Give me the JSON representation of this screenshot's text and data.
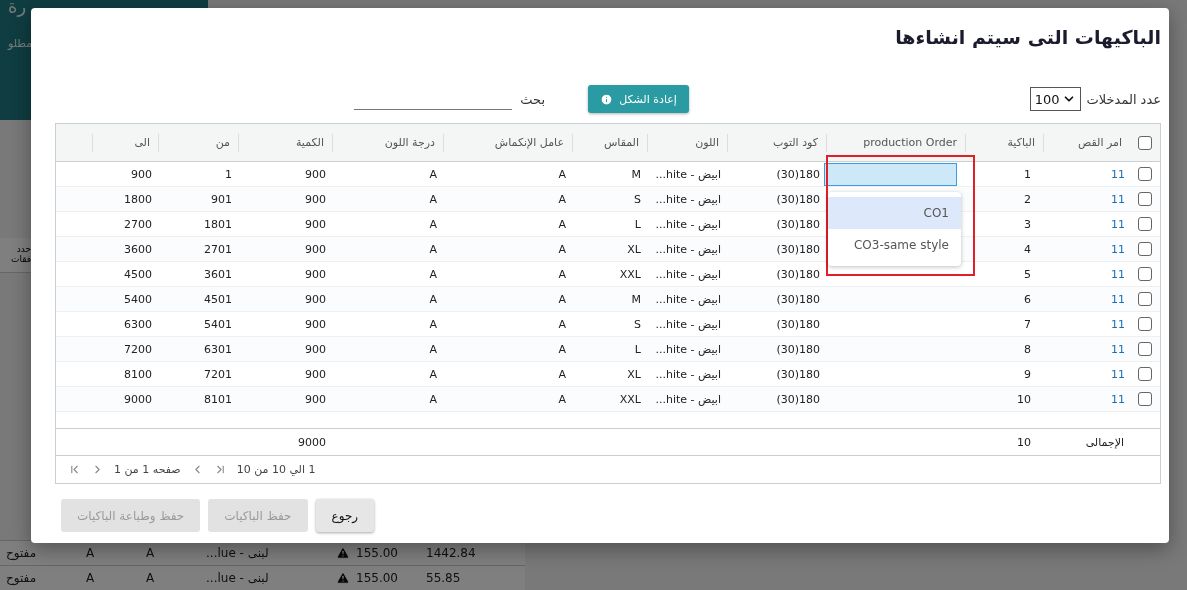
{
  "background": {
    "header_title": "رة",
    "header_subtitle": "مطلو",
    "side_text": [
      "حدد",
      "فقات"
    ],
    "rows": [
      {
        "column_1": "1442.84",
        "column_2": "155.00",
        "warning": true,
        "column_3": "لبنى - lue...",
        "column_4": "A",
        "column_5": "A",
        "column_6": "مفتوح"
      },
      {
        "column_1": "55.85",
        "column_2": "155.00",
        "warning": true,
        "column_3": "لبنى - lue...",
        "column_4": "A",
        "column_5": "A",
        "column_6": "مفتوح"
      }
    ]
  },
  "dialog": {
    "title": "الباكيهات التى سيتم انشاءها",
    "page_size": {
      "label": "عدد المدخلات",
      "value": "100"
    },
    "reset_button": "إعادة الشكل",
    "search": {
      "label": "بحث"
    },
    "table": {
      "select_all_checked": false,
      "columns": [
        "امر القص",
        "الباكية",
        "production Order",
        "كود التوب",
        "اللون",
        "المقاس",
        "عامل الإنكماش",
        "درجة اللون",
        "الكمية",
        "من",
        "الى"
      ],
      "rows": [
        {
          "checked": false,
          "cut_order": "11",
          "bundle": "1",
          "editing": true,
          "top_code": "180(30)",
          "colour_name": "ابيض - hite...",
          "size": "M",
          "shrinkage": "A",
          "shade": "A",
          "quantity": "900",
          "from": "1",
          "to": "900"
        },
        {
          "checked": false,
          "cut_order": "11",
          "bundle": "2",
          "editing": false,
          "top_code": "180(30)",
          "colour_name": "ابيض - hite...",
          "size": "S",
          "shrinkage": "A",
          "shade": "A",
          "quantity": "900",
          "from": "901",
          "to": "1800"
        },
        {
          "checked": false,
          "cut_order": "11",
          "bundle": "3",
          "editing": false,
          "top_code": "180(30)",
          "colour_name": "ابيض - hite...",
          "size": "L",
          "shrinkage": "A",
          "shade": "A",
          "quantity": "900",
          "from": "1801",
          "to": "2700"
        },
        {
          "checked": false,
          "cut_order": "11",
          "bundle": "4",
          "editing": false,
          "top_code": "180(30)",
          "colour_name": "ابيض - hite...",
          "size": "XL",
          "shrinkage": "A",
          "shade": "A",
          "quantity": "900",
          "from": "2701",
          "to": "3600"
        },
        {
          "checked": false,
          "cut_order": "11",
          "bundle": "5",
          "editing": false,
          "top_code": "180(30)",
          "colour_name": "ابيض - hite...",
          "size": "XXL",
          "shrinkage": "A",
          "shade": "A",
          "quantity": "900",
          "from": "3601",
          "to": "4500"
        },
        {
          "checked": false,
          "cut_order": "11",
          "bundle": "6",
          "editing": false,
          "top_code": "180(30)",
          "colour_name": "ابيض - hite...",
          "size": "M",
          "shrinkage": "A",
          "shade": "A",
          "quantity": "900",
          "from": "4501",
          "to": "5400"
        },
        {
          "checked": false,
          "cut_order": "11",
          "bundle": "7",
          "editing": false,
          "top_code": "180(30)",
          "colour_name": "ابيض - hite...",
          "size": "S",
          "shrinkage": "A",
          "shade": "A",
          "quantity": "900",
          "from": "5401",
          "to": "6300"
        },
        {
          "checked": false,
          "cut_order": "11",
          "bundle": "8",
          "editing": false,
          "top_code": "180(30)",
          "colour_name": "ابيض - hite...",
          "size": "L",
          "shrinkage": "A",
          "shade": "A",
          "quantity": "900",
          "from": "6301",
          "to": "7200"
        },
        {
          "checked": false,
          "cut_order": "11",
          "bundle": "9",
          "editing": false,
          "top_code": "180(30)",
          "colour_name": "ابيض - hite...",
          "size": "XL",
          "shrinkage": "A",
          "shade": "A",
          "quantity": "900",
          "from": "7201",
          "to": "8100"
        },
        {
          "checked": false,
          "cut_order": "11",
          "bundle": "10",
          "editing": false,
          "top_code": "180(30)",
          "colour_name": "ابيض - hite...",
          "size": "XXL",
          "shrinkage": "A",
          "shade": "A",
          "quantity": "900",
          "from": "8101",
          "to": "9000"
        }
      ],
      "dropdown": {
        "options": [
          {
            "label": "CO1",
            "selected": true
          },
          {
            "label": "CO3-same style",
            "selected": false
          }
        ]
      },
      "totals": {
        "label": "الإجمالى",
        "bundle": "10",
        "quantity": "9000"
      },
      "pager": {
        "range": "1 الي 10 من 10",
        "page": "صفحه 1 من 1"
      }
    },
    "buttons": [
      {
        "label": "رجوع",
        "disabled": false
      },
      {
        "label": "حفظ الباكيات",
        "disabled": true
      },
      {
        "label": "حفظ وطباعة الباكيات",
        "disabled": true
      }
    ]
  }
}
